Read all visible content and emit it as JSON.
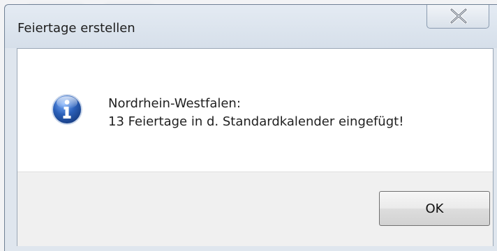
{
  "window": {
    "title": "Feiertage erstellen"
  },
  "titlebar": {
    "close_icon": "close-icon"
  },
  "message": {
    "icon": "info-icon",
    "line1": "Nordrhein-Westfalen:",
    "line2": "13 Feiertage in d. Standardkalender eingefügt!"
  },
  "buttons": {
    "ok_label": "OK"
  },
  "colors": {
    "titlebar": "#dfe6ee",
    "footer": "#f0f0f0",
    "info_blue": "#2a5fb8"
  }
}
